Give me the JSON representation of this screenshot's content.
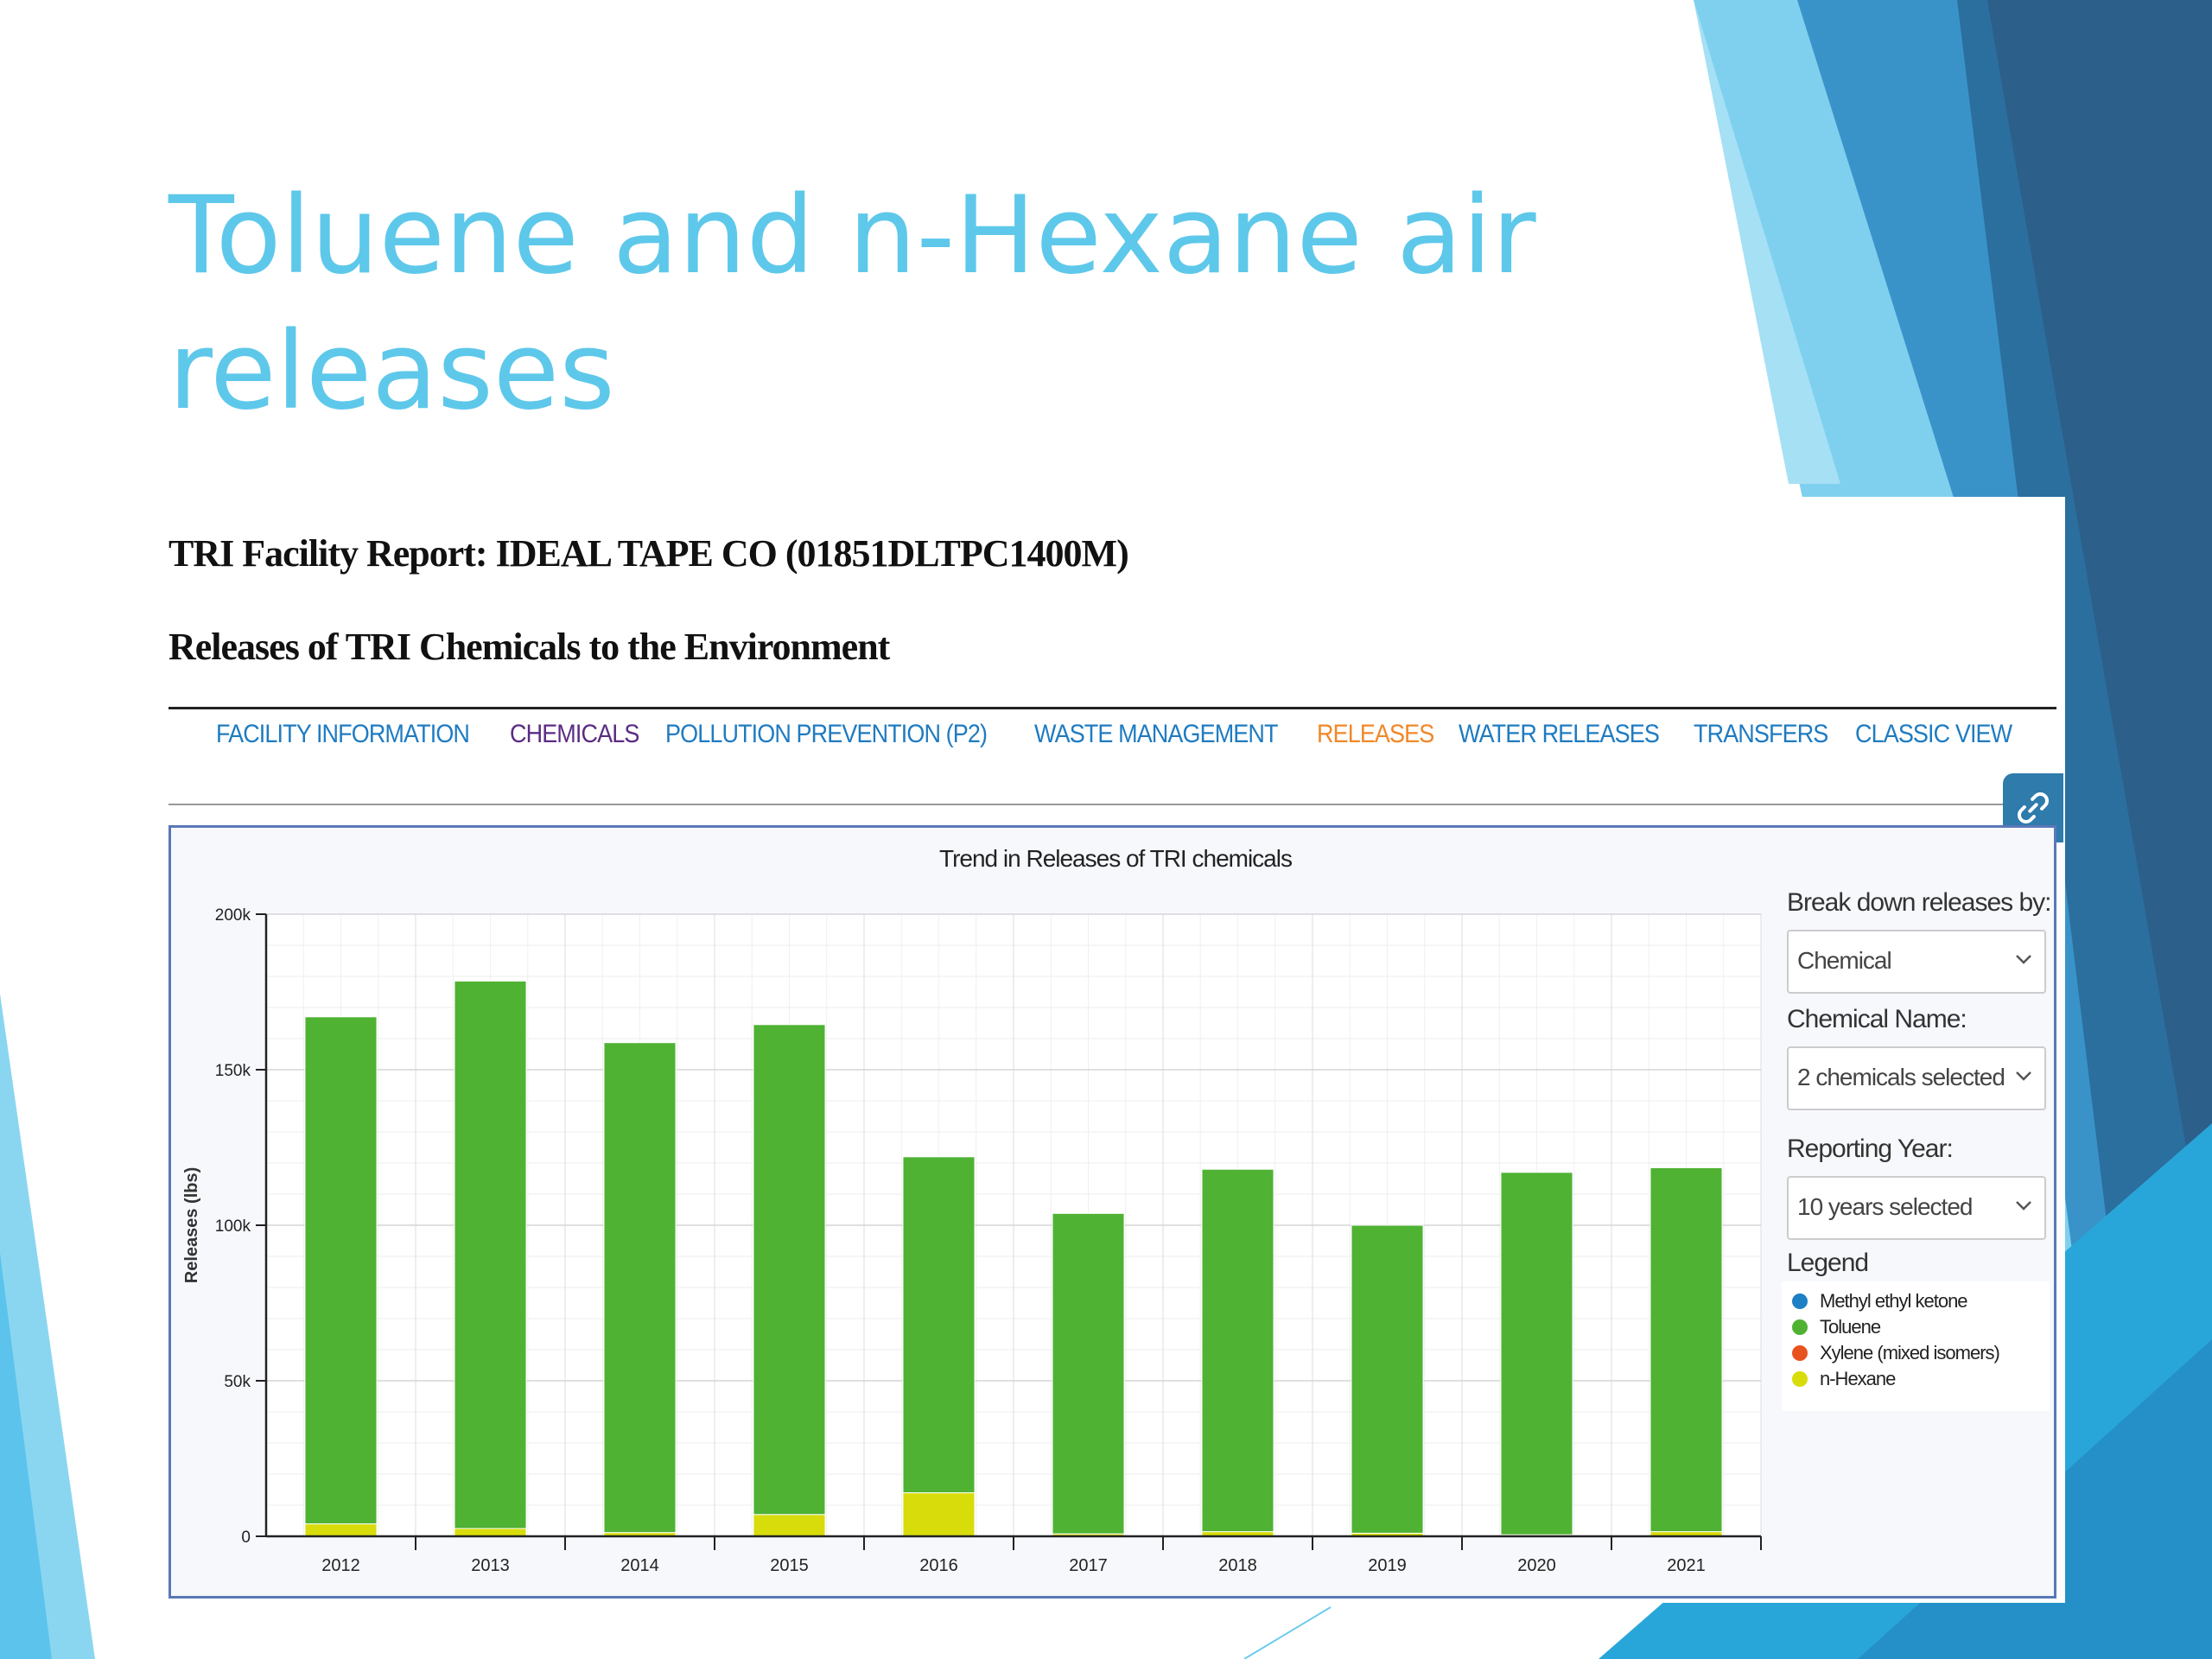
{
  "slide": {
    "title": "Toluene and n-Hexane air releases"
  },
  "report": {
    "title": "TRI Facility Report: IDEAL TAPE CO (01851DLTPC1400M)",
    "section": "Releases of TRI Chemicals to the Environment"
  },
  "nav": [
    {
      "label": "FACILITY INFORMATION",
      "state": "link"
    },
    {
      "label": "CHEMICALS",
      "state": "visited"
    },
    {
      "label": "POLLUTION PREVENTION (P2)",
      "state": "link"
    },
    {
      "label": "WASTE MANAGEMENT",
      "state": "link"
    },
    {
      "label": "RELEASES",
      "state": "active"
    },
    {
      "label": "WATER RELEASES",
      "state": "link"
    },
    {
      "label": "TRANSFERS",
      "state": "link"
    },
    {
      "label": "CLASSIC VIEW",
      "state": "link"
    }
  ],
  "link_icon": "link-icon",
  "controls": {
    "breakdown_label": "Break down releases by:",
    "breakdown_value": "Chemical",
    "chemical_label": "Chemical Name:",
    "chemical_value": "2 chemicals selected",
    "year_label": "Reporting Year:",
    "year_value": "10 years selected",
    "legend_title": "Legend"
  },
  "colors": {
    "title": "#5ec8ea",
    "nav_link": "#1f7bc1",
    "nav_visited": "#5b2c83",
    "nav_active": "#f0882a",
    "toluene": "#4fb233",
    "n_hexane": "#d8dc0a",
    "methyl_ethyl_ketone": "#1d7fc4",
    "xylene": "#e8521f"
  },
  "chart_data": {
    "type": "bar",
    "stacked": true,
    "title": "Trend in Releases of TRI chemicals",
    "xlabel": "",
    "ylabel": "Releases (lbs)",
    "ylim": [
      0,
      200000
    ],
    "yticks": [
      0,
      50000,
      100000,
      150000,
      200000
    ],
    "ytick_labels": [
      "0",
      "50k",
      "100k",
      "150k",
      "200k"
    ],
    "grid": true,
    "categories": [
      "2012",
      "2013",
      "2014",
      "2015",
      "2016",
      "2017",
      "2018",
      "2019",
      "2020",
      "2021"
    ],
    "series": [
      {
        "name": "n-Hexane",
        "color": "#d8dc0a",
        "values": [
          4000,
          2500,
          1200,
          7000,
          14000,
          800,
          1500,
          1000,
          500,
          1500
        ]
      },
      {
        "name": "Toluene",
        "color": "#4fb233",
        "values": [
          163000,
          176000,
          157500,
          157500,
          108000,
          103000,
          116500,
          99000,
          116500,
          117000
        ]
      }
    ],
    "legend": {
      "position": "right",
      "entries": [
        {
          "name": "Methyl ethyl ketone",
          "color": "#1d7fc4"
        },
        {
          "name": "Toluene",
          "color": "#4fb233"
        },
        {
          "name": "Xylene (mixed isomers)",
          "color": "#e8521f"
        },
        {
          "name": "n-Hexane",
          "color": "#d8dc0a"
        }
      ]
    }
  }
}
